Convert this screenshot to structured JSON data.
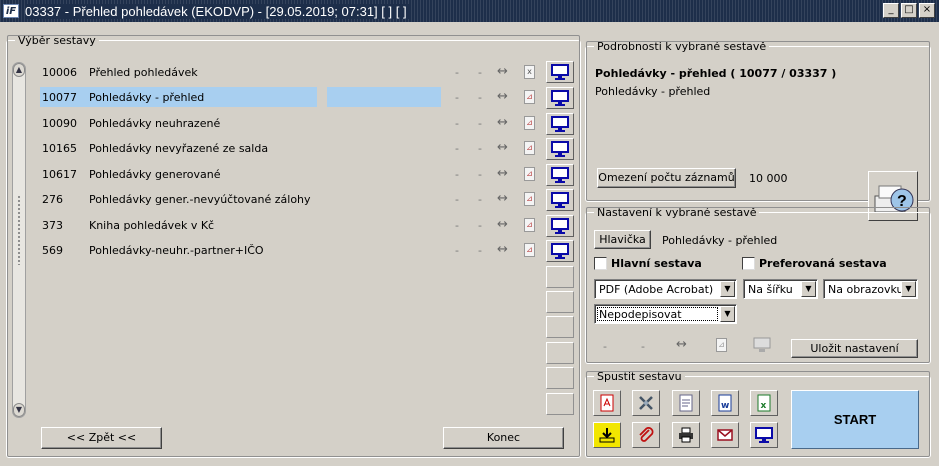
{
  "window": {
    "app_icon_text": "iF",
    "title": "03337 - Přehled pohledávek (EKODVP) - [29.05.2019; 07:31]  [ ]  [ ]",
    "controls": [
      "_",
      "□",
      "×"
    ]
  },
  "selection": {
    "legend": "Výběr sestavy",
    "dash": "-",
    "reports": [
      {
        "id": "10006",
        "name": "Přehled pohledávek",
        "file_icon": "excel-file-icon",
        "selected": false
      },
      {
        "id": "10077",
        "name": "Pohledávky - přehled",
        "file_icon": "pdf-file-icon",
        "selected": true
      },
      {
        "id": "10090",
        "name": "Pohledávky neuhrazené",
        "file_icon": "pdf-file-icon",
        "selected": false
      },
      {
        "id": "10165",
        "name": "Pohledávky nevyřazené ze salda",
        "file_icon": "pdf-file-icon",
        "selected": false
      },
      {
        "id": "10617",
        "name": "Pohledávky generované",
        "file_icon": "pdf-file-icon",
        "selected": false
      },
      {
        "id": "276",
        "name": "Pohledávky gener.-nevyúčtované zálohy",
        "file_icon": "pdf-file-icon",
        "selected": false
      },
      {
        "id": "373",
        "name": "Kniha pohledávek v Kč",
        "file_icon": "pdf-file-icon",
        "selected": false
      },
      {
        "id": "569",
        "name": "Pohledávky-neuhr.-partner+IČO",
        "file_icon": "pdf-file-icon",
        "selected": false
      }
    ],
    "back_label": "<< Zpět <<",
    "end_label": "Konec"
  },
  "details": {
    "legend": "Podrobnosti k vybrané sestavě",
    "title": "Pohledávky - přehled ( 10077 / 03337 )",
    "subtitle": "Pohledávky - přehled",
    "limit_label": "Omezení počtu záznamů",
    "limit_value": "10 000"
  },
  "settings": {
    "legend": "Nastavení k vybrané sestavě",
    "header_label": "Hlavička",
    "header_value": "Pohledávky - přehled",
    "main_report_label": "Hlavní sestava",
    "preferred_label": "Preferovaná sestava",
    "format_value": "PDF (Adobe Acrobat)",
    "orientation_value": "Na šířku",
    "output_value": "Na obrazovku",
    "sign_value": "Nepodepisovat",
    "dash": "-",
    "save_label": "Uložit nastavení"
  },
  "run": {
    "legend": "Spustit sestavu",
    "start_label": "START"
  },
  "colors": {
    "selection": "#a8cff0",
    "start": "#a8cff0",
    "monitor": "#0a0aa8",
    "titlebar": "#1d2e4a"
  }
}
